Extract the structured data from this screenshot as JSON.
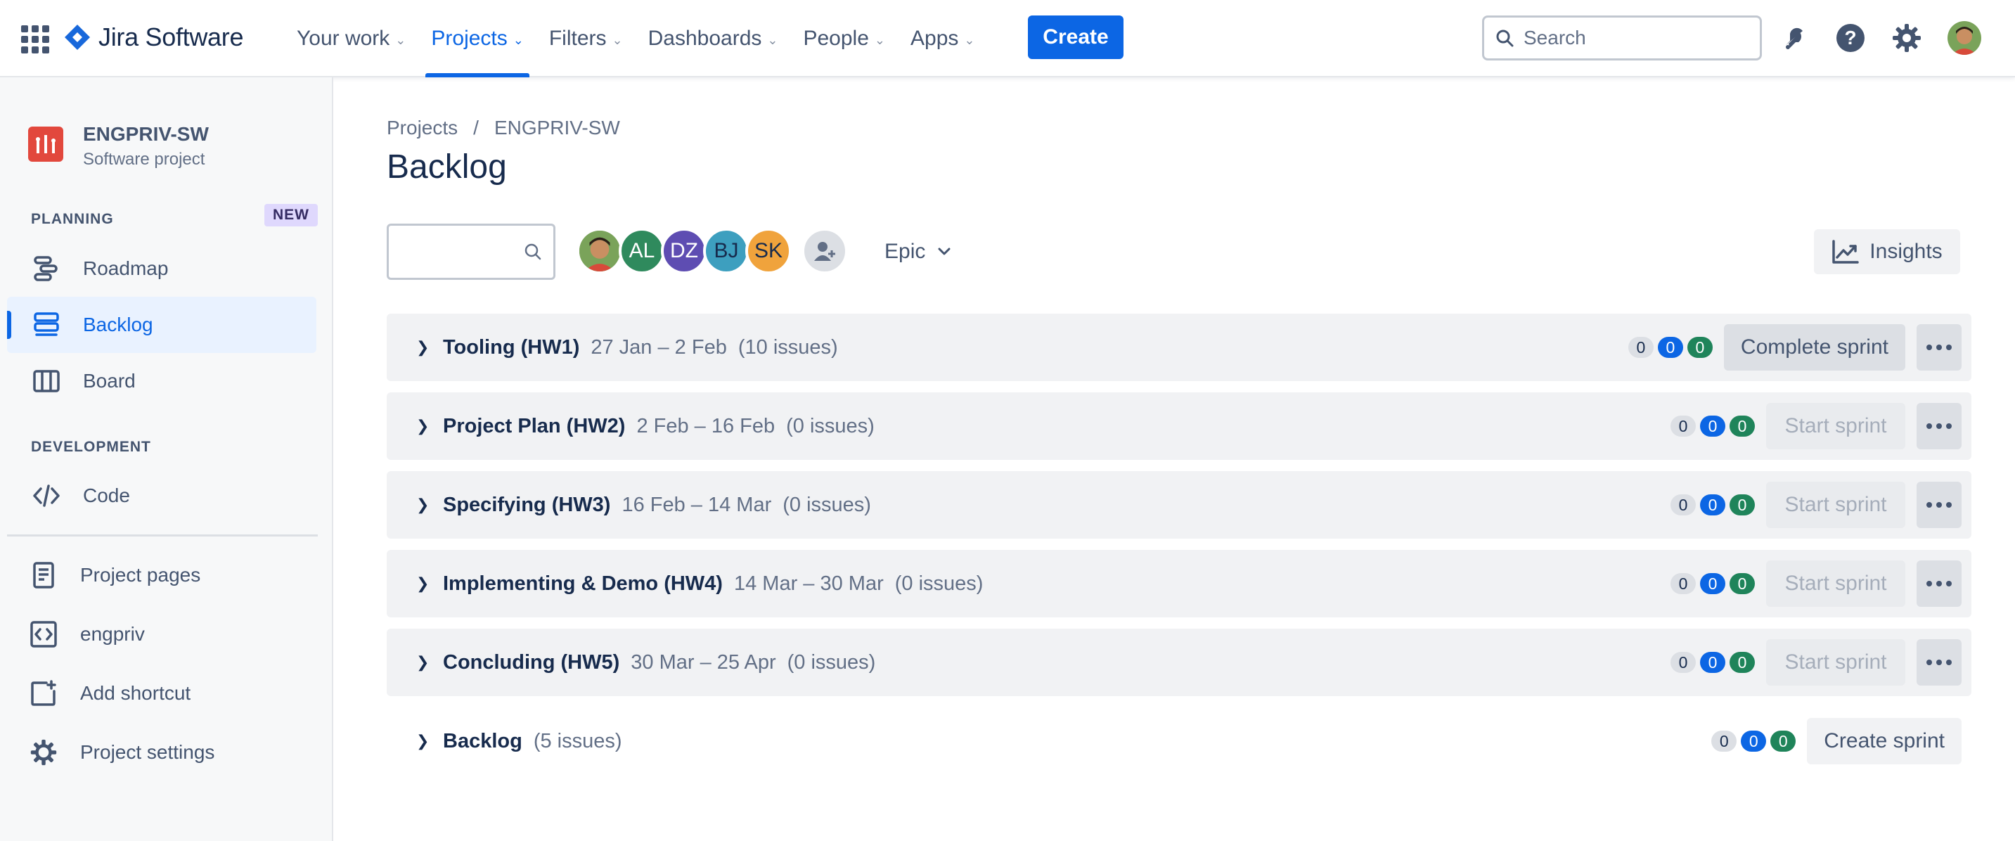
{
  "app": {
    "name": "Jira Software"
  },
  "topnav": {
    "items": [
      {
        "label": "Your work"
      },
      {
        "label": "Projects"
      },
      {
        "label": "Filters"
      },
      {
        "label": "Dashboards"
      },
      {
        "label": "People"
      },
      {
        "label": "Apps"
      }
    ],
    "active": "Projects",
    "create_label": "Create",
    "search_placeholder": "Search"
  },
  "sidebar": {
    "project_name": "ENGPRIV-SW",
    "project_type": "Software project",
    "planning_label": "PLANNING",
    "new_badge": "NEW",
    "planning_items": [
      {
        "label": "Roadmap",
        "icon": "roadmap-icon"
      },
      {
        "label": "Backlog",
        "icon": "backlog-icon",
        "active": true
      },
      {
        "label": "Board",
        "icon": "board-icon"
      }
    ],
    "development_label": "DEVELOPMENT",
    "development_items": [
      {
        "label": "Code",
        "icon": "code-icon"
      }
    ],
    "other_items": [
      {
        "label": "Project pages",
        "icon": "page-icon"
      },
      {
        "label": "engpriv",
        "icon": "repo-icon"
      },
      {
        "label": "Add shortcut",
        "icon": "add-shortcut-icon"
      },
      {
        "label": "Project settings",
        "icon": "gear-icon"
      }
    ]
  },
  "main": {
    "breadcrumb": {
      "root": "Projects",
      "separator": "/",
      "current": "ENGPRIV-SW"
    },
    "title": "Backlog",
    "avatars": [
      "AL",
      "DZ",
      "BJ",
      "SK"
    ],
    "epic_label": "Epic",
    "insights_label": "Insights",
    "sprints": [
      {
        "name": "Tooling (HW1)",
        "dates": "27 Jan – 2 Feb",
        "count": "(10 issues)",
        "todo": "0",
        "in_progress": "0",
        "done": "0",
        "action": "Complete sprint"
      },
      {
        "name": "Project Plan (HW2)",
        "dates": "2 Feb – 16 Feb",
        "count": "(0 issues)",
        "todo": "0",
        "in_progress": "0",
        "done": "0",
        "action": "Start sprint"
      },
      {
        "name": "Specifying (HW3)",
        "dates": "16 Feb – 14 Mar",
        "count": "(0 issues)",
        "todo": "0",
        "in_progress": "0",
        "done": "0",
        "action": "Start sprint"
      },
      {
        "name": "Implementing & Demo (HW4)",
        "dates": "14 Mar – 30 Mar",
        "count": "(0 issues)",
        "todo": "0",
        "in_progress": "0",
        "done": "0",
        "action": "Start sprint"
      },
      {
        "name": "Concluding (HW5)",
        "dates": "30 Mar – 25 Apr",
        "count": "(0 issues)",
        "todo": "0",
        "in_progress": "0",
        "done": "0",
        "action": "Start sprint"
      }
    ],
    "backlog": {
      "name": "Backlog",
      "count": "(5 issues)",
      "todo": "0",
      "in_progress": "0",
      "done": "0",
      "action": "Create sprint"
    }
  },
  "colors": {
    "brand_blue": "#0c66e4",
    "avatar_al": "#2f8a5d",
    "avatar_dz": "#5e4db2",
    "avatar_bj": "#3d9fbf",
    "avatar_sk": "#f0a33c",
    "project_icon": "#e2483d"
  }
}
